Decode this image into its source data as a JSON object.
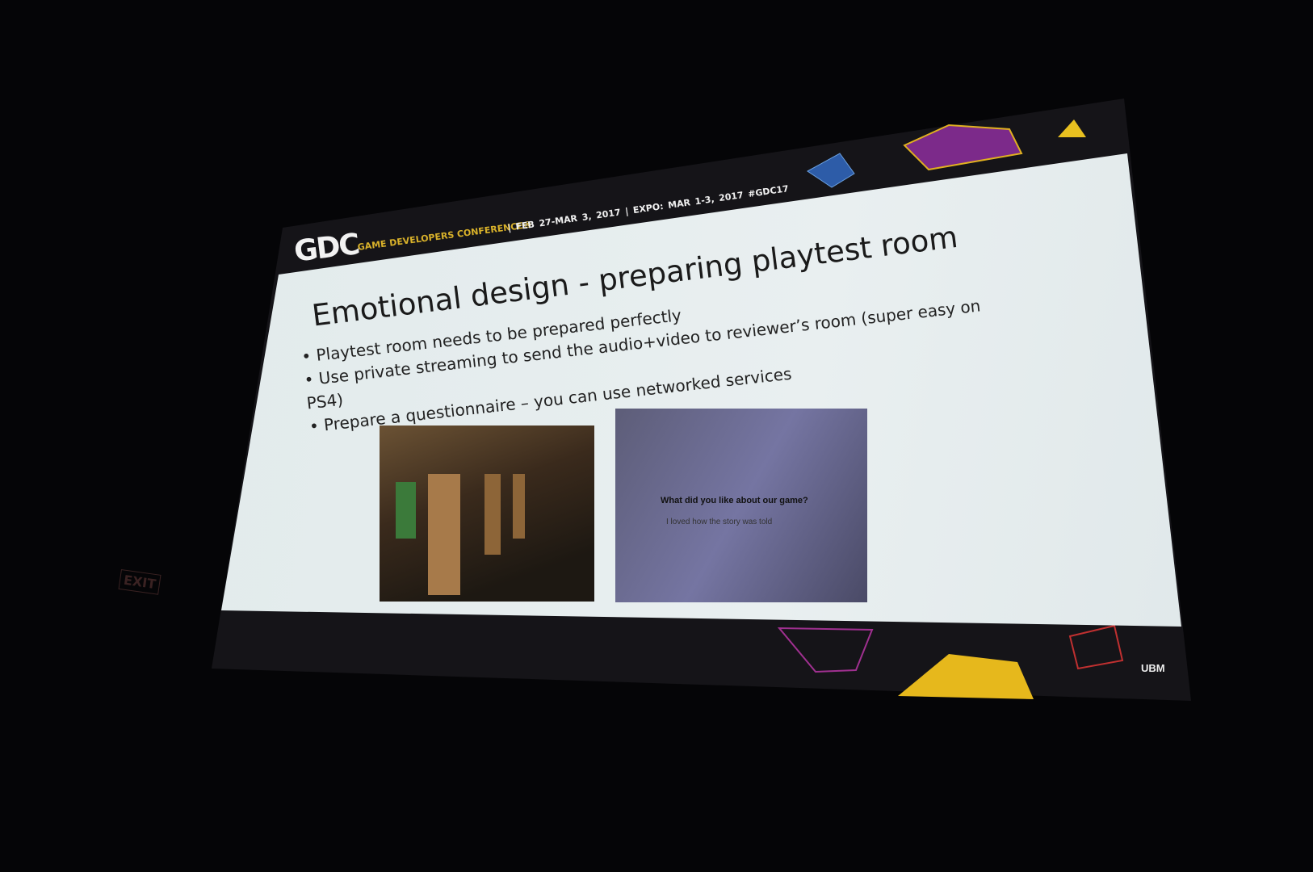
{
  "header": {
    "logo": "GDC",
    "conference": "GAME DEVELOPERS CONFERENCE®",
    "dates": "| FEB 27-MAR 3, 2017 | EXPO: MAR 1-3, 2017 #GDC17"
  },
  "slide": {
    "title": "Emotional design - preparing playtest room",
    "bullets": [
      "• Playtest room needs to be prepared perfectly",
      "• Use private streaming to send the audio+video to reviewer’s room (super easy on",
      "PS4)",
      "• Prepare a questionnaire – you can use networked services"
    ],
    "questionnaire": {
      "question": "What did you like about our game?",
      "answer": "I loved how the story was told"
    }
  },
  "footer": {
    "brand": "UBM"
  },
  "room": {
    "exit_sign": "EXIT"
  },
  "colors": {
    "accent_yellow": "#d8b12a",
    "slide_bg": "#e4ecee",
    "bar": "#151418"
  }
}
